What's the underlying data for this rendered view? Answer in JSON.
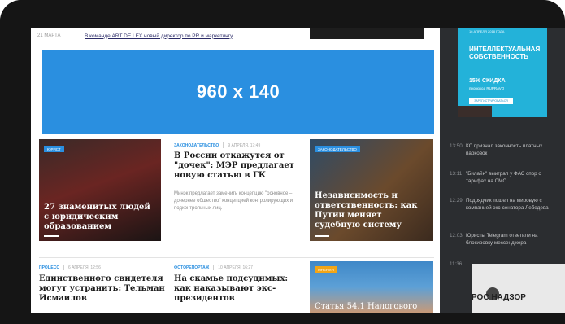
{
  "top_news": {
    "date": "21 МАРТА",
    "link": "В команде ART DE LEX новый директор по PR и маркетингу"
  },
  "banner": {
    "text": "960 x 140"
  },
  "sidebar": {
    "ad": {
      "line1": "16 АПРЕЛЯ 2018 ГОДА",
      "title_1": "ИНТЕЛЛЕКТУАЛЬНАЯ",
      "title_2": "СОБСТВЕННОСТЬ",
      "discount": "15% СКИДКА",
      "promo": "промокод RUPRAVO",
      "button": "ЗАРЕГИСТРИРОВАТЬСЯ"
    },
    "news": [
      {
        "time": "13:50",
        "text": "КС признал законность платных парковок"
      },
      {
        "time": "13:11",
        "text": "\"Билайн\" выиграл у ФАС спор о тарифах на СМС"
      },
      {
        "time": "12:29",
        "text": "Подрядчик пошел на мировую с компанией экс-сенатора Лебедева"
      },
      {
        "time": "12:03",
        "text": "Юристы Telegram ответили на блокировку мессенджера"
      },
      {
        "time": "11:36",
        "text": ""
      }
    ],
    "image_logo": "РОС   НАДЗОР"
  },
  "cards": [
    {
      "tag": "ЮРИСТ",
      "title": "27 знаменитых людей с юридическим образованием"
    },
    {
      "tag": "ЗАКОНОДАТЕЛЬСТВО",
      "title": "Независимость и ответственность: как Путин меняет судебную систему"
    }
  ],
  "middle": {
    "category": "ЗАКОНОДАТЕЛЬСТВО",
    "date": "9 АПРЕЛЯ, 17:49",
    "title": "В России откажутся от \"дочек\": МЭР предлагает новую статью в ГК",
    "lead": "Минэк предлагает заменить концепцию \"основное – дочернее общество\" концепцией контролирующих и подконтрольных лиц."
  },
  "row2": [
    {
      "category": "ПРОЦЕСС",
      "date": "6 АПРЕЛЯ, 12:56",
      "title": "Единственного свидетеля могут устранить: Тельман Исмаилов"
    },
    {
      "category": "ФОТОРЕПОРТАЖ",
      "date": "10 АПРЕЛЯ, 16:27",
      "title": "На скамье подсудимых: как наказывают экс-президентов"
    },
    {
      "tag": "МНЕНИЯ",
      "title": "Статья 54.1 Налогового"
    }
  ]
}
